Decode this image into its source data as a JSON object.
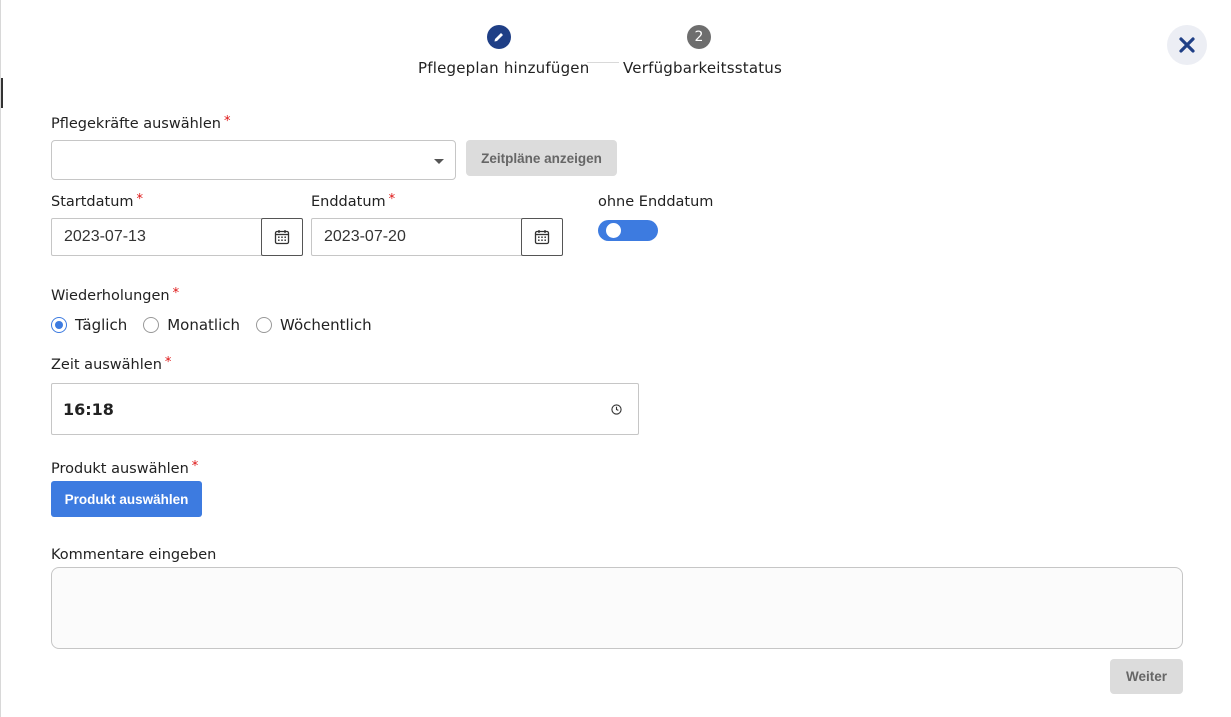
{
  "stepper": {
    "step1": {
      "label": "Pflegeplan hinzufügen",
      "icon": "pencil-icon"
    },
    "step2": {
      "number": "2",
      "label": "Verfügbarkeitsstatus"
    }
  },
  "caregivers": {
    "label": "Pflegekräfte auswählen",
    "required_mark": "*",
    "value": "",
    "show_schedules_button": "Zeitpläne anzeigen"
  },
  "start_date": {
    "label": "Startdatum",
    "required_mark": "*",
    "value": "2023-07-13"
  },
  "end_date": {
    "label": "Enddatum",
    "required_mark": "*",
    "value": "2023-07-20"
  },
  "no_end_date": {
    "label": "ohne Enddatum",
    "toggle_on": true
  },
  "repetitions": {
    "label": "Wiederholungen",
    "required_mark": "*",
    "options": [
      {
        "label": "Täglich",
        "checked": true
      },
      {
        "label": "Monatlich",
        "checked": false
      },
      {
        "label": "Wöchentlich",
        "checked": false
      }
    ]
  },
  "time": {
    "label": "Zeit auswählen",
    "required_mark": "*",
    "value": "16:18"
  },
  "product": {
    "label": "Produkt auswählen",
    "required_mark": "*",
    "button": "Produkt auswählen"
  },
  "comments": {
    "label": "Kommentare eingeben",
    "value": ""
  },
  "footer": {
    "next_button": "Weiter"
  },
  "colors": {
    "primary": "#3d7be0",
    "step_active": "#1f3f86",
    "required": "#dd1111"
  }
}
